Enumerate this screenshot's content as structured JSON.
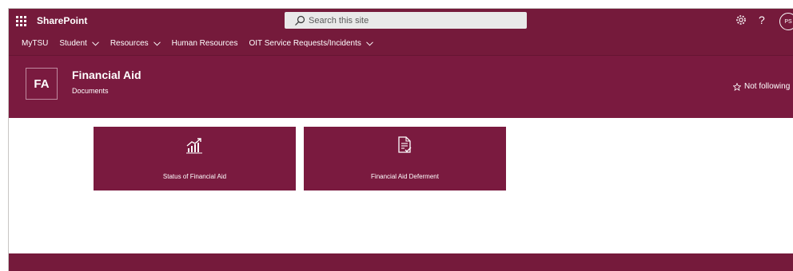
{
  "suite_bar": {
    "app_launcher_icon": "waffle-icon",
    "brand": "SharePoint",
    "search_placeholder": "Search this site",
    "settings_icon": "gear-icon",
    "help_label": "?",
    "avatar_initials": "PS"
  },
  "hub_nav": {
    "items": [
      {
        "label": "MyTSU",
        "has_dropdown": false
      },
      {
        "label": "Student",
        "has_dropdown": true
      },
      {
        "label": "Resources",
        "has_dropdown": true
      },
      {
        "label": "Human Resources",
        "has_dropdown": false
      },
      {
        "label": "OIT Service Requests/Incidents",
        "has_dropdown": true
      }
    ]
  },
  "site_header": {
    "logo_initials": "FA",
    "title": "Financial Aid",
    "subtitle": "Documents",
    "follow_label": "Not following"
  },
  "tiles": [
    {
      "label": "Status of Financial Aid",
      "icon": "chart-growth-icon"
    },
    {
      "label": "Financial Aid Deferment",
      "icon": "document-check-icon"
    }
  ],
  "colors": {
    "brand": "#751a3b",
    "header": "#7a1a3f",
    "search_bg": "#e9e9e9"
  }
}
